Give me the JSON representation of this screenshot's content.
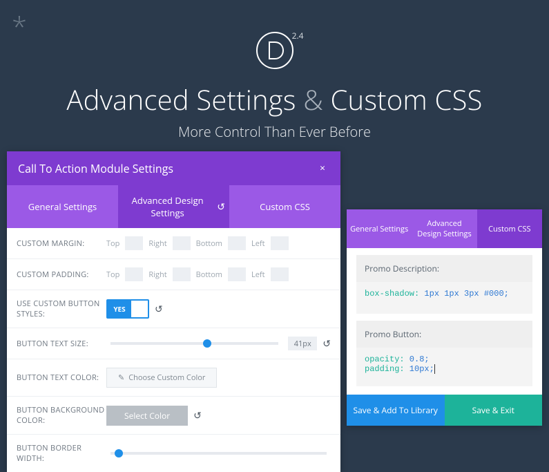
{
  "hero": {
    "version": "2.4",
    "title_pre": "Advanced Settings ",
    "title_amp": "&",
    "title_post": " Custom CSS",
    "subtitle": "More Control Than Ever Before"
  },
  "modal": {
    "title": "Call To Action Module Settings",
    "tabs": {
      "general": "General Settings",
      "advanced": "Advanced Design Settings",
      "css": "Custom CSS"
    },
    "fields": {
      "custom_margin": "CUSTOM MARGIN:",
      "custom_padding": "CUSTOM PADDING:",
      "use_custom_btn": "USE CUSTOM BUTTON STYLES:",
      "btn_text_size": "BUTTON TEXT SIZE:",
      "btn_text_color": "BUTTON TEXT COLOR:",
      "btn_bg_color": "BUTTON BACKGROUND COLOR:",
      "btn_border_width": "BUTTON BORDER WIDTH:"
    },
    "spacing": {
      "top": "Top",
      "right": "Right",
      "bottom": "Bottom",
      "left": "Left"
    },
    "toggle_yes": "YES",
    "text_size_value": "41px",
    "choose_color": "Choose Custom Color",
    "select_color": "Select Color"
  },
  "panel": {
    "tabs": {
      "general": "General Settings",
      "advanced": "Advanced Design Settings",
      "css": "Custom CSS"
    },
    "promo_desc_label": "Promo Description:",
    "promo_desc_code": "box-shadow: 1px 1px 3px #000;",
    "promo_btn_label": "Promo Button:",
    "promo_btn_line1_k": "opacity:",
    "promo_btn_line1_v": " 0.8;",
    "promo_btn_line2_k": "padding:",
    "promo_btn_line2_v": " 10px;",
    "save_lib": "Save & Add To Library",
    "save_exit": "Save & Exit"
  }
}
